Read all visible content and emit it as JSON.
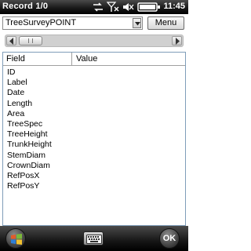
{
  "titlebar": {
    "title": "Record 1/0",
    "clock": "11:45",
    "icons": [
      "sync-arrows-icon",
      "signal-strength-icon",
      "speaker-muted-icon",
      "battery-icon"
    ]
  },
  "toolbar": {
    "layer_select_value": "TreeSurveyPOINT",
    "menu_label": "Menu"
  },
  "grid": {
    "columns": [
      "Field",
      "Value"
    ],
    "rows": [
      {
        "field": "ID",
        "value": ""
      },
      {
        "field": "Label",
        "value": ""
      },
      {
        "field": "Date",
        "value": ""
      },
      {
        "field": "Length",
        "value": ""
      },
      {
        "field": "Area",
        "value": ""
      },
      {
        "field": "TreeSpec",
        "value": ""
      },
      {
        "field": "TreeHeight",
        "value": ""
      },
      {
        "field": "TrunkHeight",
        "value": ""
      },
      {
        "field": "StemDiam",
        "value": ""
      },
      {
        "field": "CrownDiam",
        "value": ""
      },
      {
        "field": "RefPosX",
        "value": ""
      },
      {
        "field": "RefPosY",
        "value": ""
      }
    ]
  },
  "softkeys": {
    "left_icon": "windows-start-icon",
    "center_icon": "keyboard-icon",
    "right_label": "OK"
  },
  "colors": {
    "titlebar": "#000000",
    "grid_border": "#7f9db9",
    "bottombar": "#1a1a1a"
  }
}
